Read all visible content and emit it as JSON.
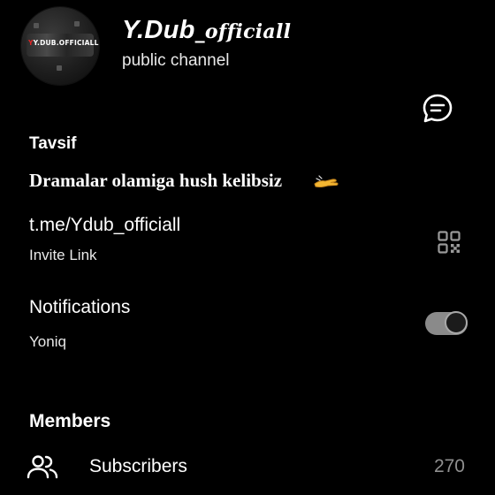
{
  "header": {
    "channel_name_main": "Y.Dub",
    "channel_name_tail": "_officiall",
    "channel_type": "public channel",
    "avatar_text": "Y.DUB.OFFICIALL"
  },
  "description": {
    "heading": "Tavsif",
    "text": "Dramalar olamiga hush kelibsiz",
    "emoji_icon": "flying-hand-icon"
  },
  "link": {
    "url": "t.me/Ydub_officiall",
    "label": "Invite Link"
  },
  "notifications": {
    "title": "Notifications",
    "status": "Yoniq",
    "enabled": true
  },
  "members": {
    "heading": "Members",
    "subscribers_label": "Subscribers",
    "subscribers_count": "270"
  },
  "colors": {
    "background": "#000000",
    "text": "#ffffff",
    "muted": "#8f8f8f",
    "toggle_track": "#8a8a8a"
  }
}
